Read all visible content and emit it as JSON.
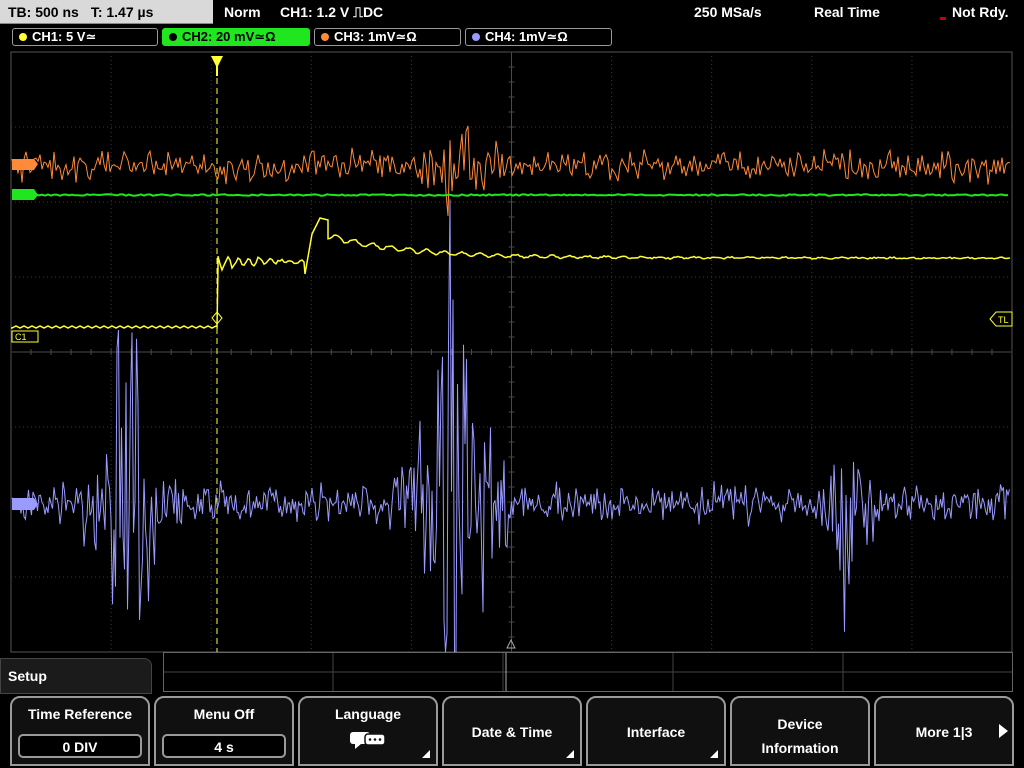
{
  "topbar": {
    "timebase": "TB: 500 ns",
    "trigger_time": "T: 1.47 µs",
    "mode": "Norm",
    "trigger": "CH1: 1.2 V ⎍DC",
    "sample_rate": "250 MSa/s",
    "acquisition": "Real Time",
    "status": "Not Rdy."
  },
  "channels": [
    {
      "label": "CH1: 5 V≃",
      "color": "#ffff33"
    },
    {
      "label": "CH2: 20 mV≃Ω",
      "color": "#1fe61f"
    },
    {
      "label": "CH3: 1mV≃Ω",
      "color": "#ff8a3a"
    },
    {
      "label": "CH4: 1mV≃Ω",
      "color": "#9a9aff"
    }
  ],
  "markers": {
    "ch1": "C1",
    "trigger_level": "TL"
  },
  "menu": {
    "title": "Setup",
    "time_reference": {
      "label": "Time Reference",
      "value": "0 DIV"
    },
    "menu_off": {
      "label": "Menu Off",
      "value": "4 s"
    },
    "language": {
      "label": "Language"
    },
    "date_time": {
      "label": "Date & Time"
    },
    "interface": {
      "label": "Interface"
    },
    "device_info": {
      "line1": "Device",
      "line2": "Information"
    },
    "more": {
      "label": "More 1|3"
    }
  },
  "colors": {
    "grid": "#3a3a3a",
    "trigger_line": "#ffff33",
    "background": "#000000"
  },
  "icons": [
    "language-icon",
    "submenu-corner-icon",
    "next-arrow-icon",
    "trigger-marker-icon"
  ]
}
